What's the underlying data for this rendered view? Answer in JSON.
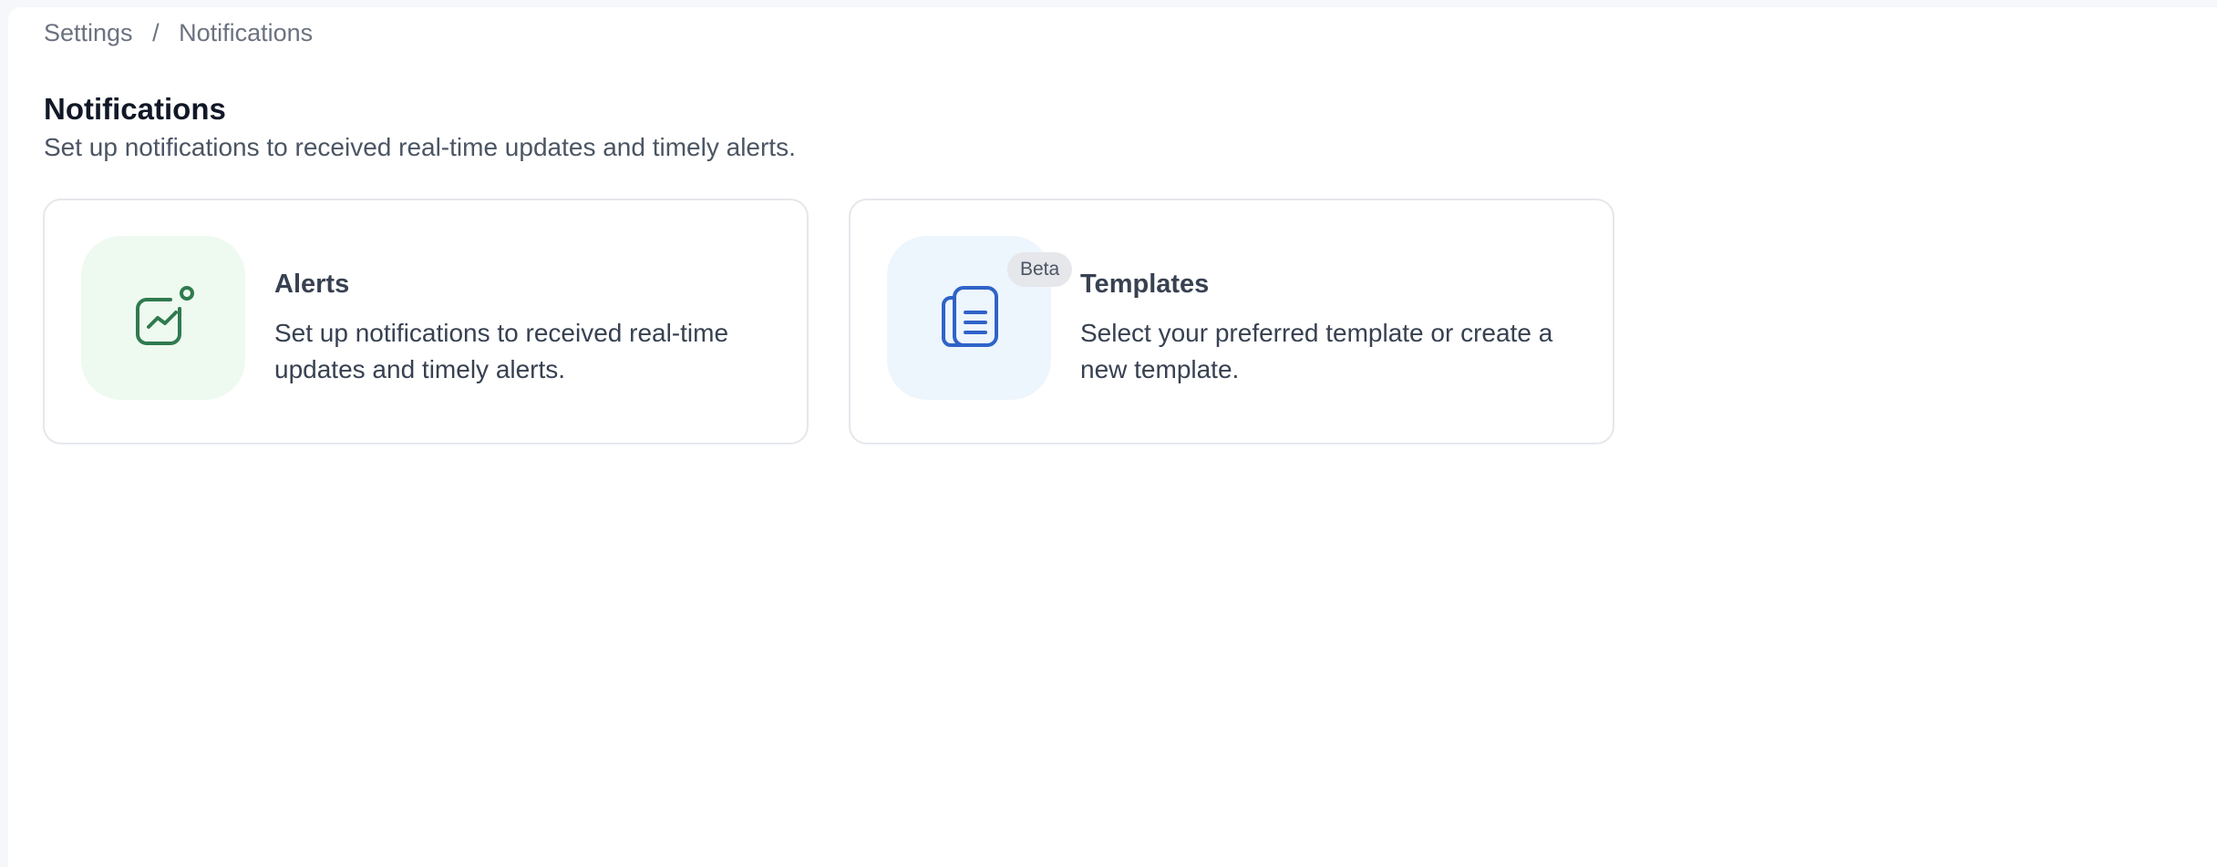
{
  "breadcrumb": {
    "items": [
      "Settings",
      "Notifications"
    ],
    "separator": "/"
  },
  "header": {
    "title": "Notifications",
    "subtitle": "Set up notifications to received real-time updates and timely alerts."
  },
  "cards": [
    {
      "title": "Alerts",
      "description": "Set up notifications to received real-time updates and timely alerts.",
      "icon": "chart-notification-icon",
      "accent": "#2f7a4f",
      "tile_bg": "#eef9ef"
    },
    {
      "title": "Templates",
      "description": "Select your preferred template or create a new template.",
      "icon": "documents-icon",
      "badge": "Beta",
      "accent": "#2f63c8",
      "tile_bg": "#edf5fd"
    }
  ]
}
